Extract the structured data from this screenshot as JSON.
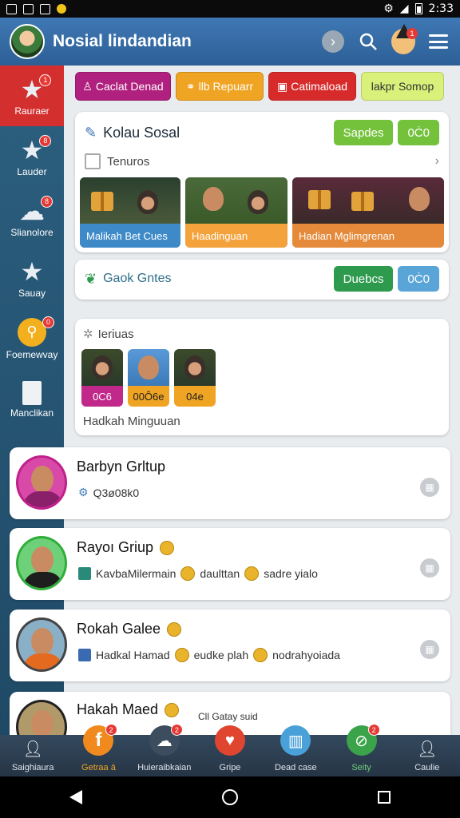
{
  "status_bar": {
    "time": "2:33"
  },
  "header": {
    "title": "Nosial lindandian",
    "notification_count": "1"
  },
  "sidebar": {
    "items": [
      {
        "label": "Rauraer",
        "icon": "star-icon",
        "badge": "1",
        "active": true
      },
      {
        "label": "Lauder",
        "icon": "star-icon",
        "badge": "8"
      },
      {
        "label": "Slianolore",
        "icon": "chat-icon",
        "badge": "8"
      },
      {
        "label": "Sauay",
        "icon": "star-icon",
        "badge": ""
      },
      {
        "label": "Foemewvay",
        "icon": "coin-icon",
        "badge": "0"
      },
      {
        "label": "Manclikan",
        "icon": "document-icon",
        "badge": ""
      }
    ]
  },
  "quick_actions": [
    {
      "label": "Caclat Denad",
      "color": "#b0207e"
    },
    {
      "label": "llb Repuarr",
      "color": "#f0a423"
    },
    {
      "label": "Catimaload",
      "color": "#d72b2b"
    },
    {
      "label": "lakpr Somop",
      "color": "#d9f07a"
    }
  ],
  "card_social": {
    "title": "Kolau Sosal",
    "btn_primary": "Sapdes",
    "btn_secondary": "0Ċ0",
    "sub_label": "Tenuros",
    "promos": [
      {
        "caption": "Malikah Bet Cues",
        "cap_color": "#3e8ac9"
      },
      {
        "caption": "Haadinguan",
        "cap_color": "#f3a23c"
      },
      {
        "caption": "Hadian Mglimgrenan",
        "cap_color": "#e58a3a"
      }
    ]
  },
  "card_goals": {
    "title": "Gaok Gntes",
    "btn_primary": "Duebcs",
    "btn_secondary": "0Ċ0"
  },
  "card_teri": {
    "title": "Ieriuas",
    "tiles": [
      {
        "value": "0C6",
        "color": "#c0288a"
      },
      {
        "value": "00Ô6e",
        "color": "#f0a423"
      },
      {
        "value": "04e",
        "color": "#f0a423"
      }
    ],
    "footer": "Hadkah Minguuan"
  },
  "contacts": [
    {
      "name": "Barbyn Grltup",
      "meta": [
        "Q3ø08k0"
      ],
      "ring": "#c0208a",
      "shirt": "#8a1f6a",
      "has_coin": false
    },
    {
      "name": "Rayoı Griup",
      "meta": [
        "KavbaMilermain",
        "daulttan",
        "sadre yialo"
      ],
      "ring": "#2fae3a",
      "shirt": "#1e1e1e",
      "has_coin": true
    },
    {
      "name": "Rokah Galee",
      "meta": [
        "Hadkal Hamad",
        "eudke plah",
        "nodrahyoiada"
      ],
      "ring": "#444444",
      "shirt": "#e46a1f",
      "has_coin": true
    },
    {
      "name": "Hakah Maed",
      "meta": [
        "Cll Gatay suid"
      ],
      "ring": "#222222",
      "shirt": "#5a4a3a",
      "has_coin": true
    }
  ],
  "bottom_nav": [
    {
      "label": "Saighiaura",
      "icon": "user-icon",
      "bg": "transparent",
      "badge": ""
    },
    {
      "label": "Getraa á",
      "icon": "facebook-icon",
      "bg": "#f08a1f",
      "badge": "2"
    },
    {
      "label": "Huieraibkaian",
      "icon": "chat-icon",
      "bg": "#3b4d5f",
      "badge": "2"
    },
    {
      "label": "Gripe",
      "icon": "heart-icon",
      "bg": "#e0452f",
      "badge": ""
    },
    {
      "label": "Dead case",
      "icon": "basket-icon",
      "bg": "#4aa0d8",
      "badge": ""
    },
    {
      "label": "Seity",
      "icon": "compass-icon",
      "bg": "#3ba34a",
      "badge": "2"
    },
    {
      "label": "Caulie",
      "icon": "user-icon",
      "bg": "transparent",
      "badge": ""
    }
  ]
}
